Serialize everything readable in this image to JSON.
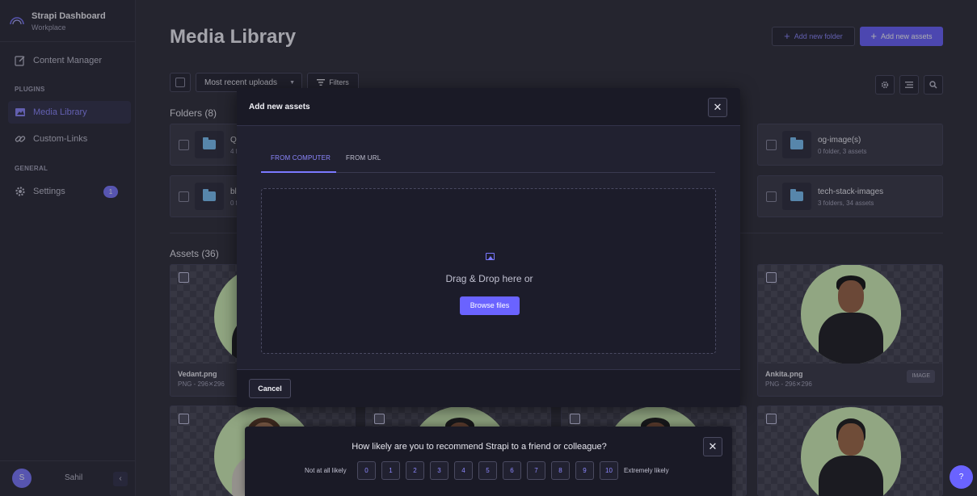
{
  "brand": {
    "title": "Strapi Dashboard",
    "subtitle": "Workplace"
  },
  "sidebar": {
    "content_manager": "Content Manager",
    "plugins_label": "PLUGINS",
    "media_library": "Media Library",
    "custom_links": "Custom-Links",
    "general_label": "GENERAL",
    "settings": "Settings",
    "settings_badge": "1",
    "user_initial": "S",
    "user_name": "Sahil",
    "collapse": "‹"
  },
  "header": {
    "title": "Media Library",
    "add_folder": "Add new folder",
    "add_assets": "Add new assets"
  },
  "toolbar": {
    "sort": "Most recent uploads",
    "filters": "Filters"
  },
  "folders": {
    "heading": "Folders (8)",
    "items": [
      {
        "name": "Q",
        "meta": "4 f"
      },
      {
        "name": "og-image(s)",
        "meta": "0 folder, 3 assets"
      },
      {
        "name": "bl",
        "meta": "0 f"
      },
      {
        "name": "tech-stack-images",
        "meta": "3 folders, 34 assets"
      }
    ]
  },
  "assets": {
    "heading": "Assets (36)",
    "items": [
      {
        "name": "Vedant.png",
        "meta": "PNG - 296✕296"
      },
      {
        "name": "Ankita.png",
        "meta": "PNG - 296✕296",
        "tag": "IMAGE"
      }
    ]
  },
  "modal": {
    "title": "Add new assets",
    "close": "✕",
    "tab_computer": "FROM COMPUTER",
    "tab_url": "FROM URL",
    "drop_text": "Drag & Drop here or",
    "browse": "Browse files",
    "cancel": "Cancel"
  },
  "nps": {
    "question": "How likely are you to recommend Strapi to a friend or colleague?",
    "low_label": "Not at all likely",
    "high_label": "Extremely likely",
    "scores": [
      "0",
      "1",
      "2",
      "3",
      "4",
      "5",
      "6",
      "7",
      "8",
      "9",
      "10"
    ],
    "close": "✕"
  },
  "help": "?",
  "colors": {
    "accent": "#6a63ff",
    "folder": "#7cc4f8",
    "portrait_bg": "#d5f5b8"
  }
}
